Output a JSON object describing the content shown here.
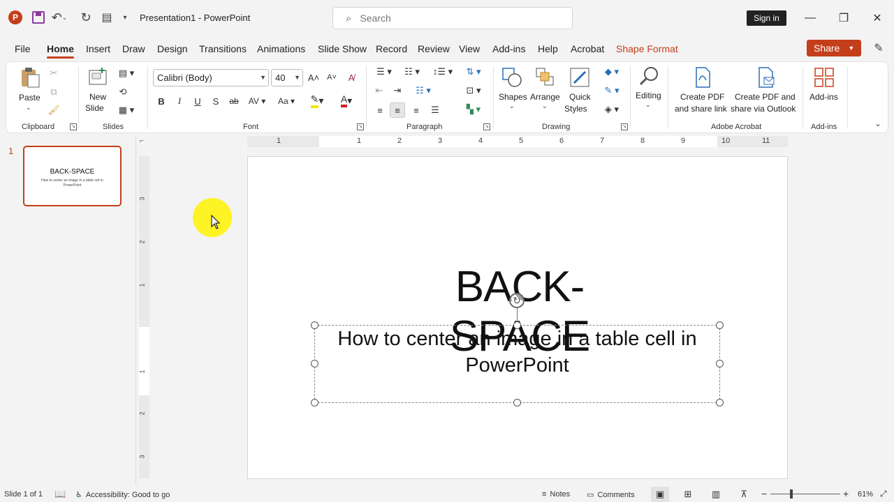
{
  "app": {
    "logo_letter": "P",
    "document_title": "Presentation1  -  PowerPoint",
    "search_placeholder": "Search",
    "sign_in": "Sign in"
  },
  "tabs": [
    "File",
    "Home",
    "Insert",
    "Draw",
    "Design",
    "Transitions",
    "Animations",
    "Slide Show",
    "Record",
    "Review",
    "View",
    "Add-ins",
    "Help",
    "Acrobat",
    "Shape Format"
  ],
  "active_tab": "Home",
  "share_label": "Share",
  "ribbon": {
    "clipboard": {
      "paste": "Paste",
      "group": "Clipboard"
    },
    "slides": {
      "new_slide_1": "New",
      "new_slide_2": "Slide",
      "group": "Slides"
    },
    "font": {
      "name": "Calibri (Body)",
      "size": "40",
      "group": "Font"
    },
    "paragraph": {
      "group": "Paragraph"
    },
    "drawing": {
      "shapes": "Shapes",
      "arrange": "Arrange",
      "quick_styles_1": "Quick",
      "quick_styles_2": "Styles",
      "group": "Drawing"
    },
    "editing": {
      "label": "Editing"
    },
    "acrobat": {
      "create_link_1": "Create PDF",
      "create_link_2": "and share link",
      "create_outlook_1": "Create PDF and",
      "create_outlook_2": "share via Outlook",
      "group": "Adobe Acrobat"
    },
    "addins": {
      "label": "Add-ins",
      "group": "Add-ins"
    }
  },
  "slides_pane": {
    "number": "1",
    "thumb_title": "BACK-SPACE",
    "thumb_subtitle": "How to center an image in a table cell in PowerPoint"
  },
  "ruler": {
    "h_ticks": [
      "1",
      "1",
      "2",
      "3",
      "4",
      "5",
      "6",
      "7",
      "8",
      "9",
      "10",
      "11"
    ],
    "v_ticks": [
      "3",
      "2",
      "1",
      "1",
      "2",
      "3"
    ]
  },
  "slide": {
    "title": "BACK-SPACE",
    "subtitle": "How to center an image in a table cell in PowerPoint"
  },
  "statusbar": {
    "slide_info": "Slide 1 of 1",
    "accessibility": "Accessibility: Good to go",
    "notes": "Notes",
    "comments": "Comments",
    "zoom": "61%"
  },
  "colors": {
    "accent": "#c43e1c"
  }
}
